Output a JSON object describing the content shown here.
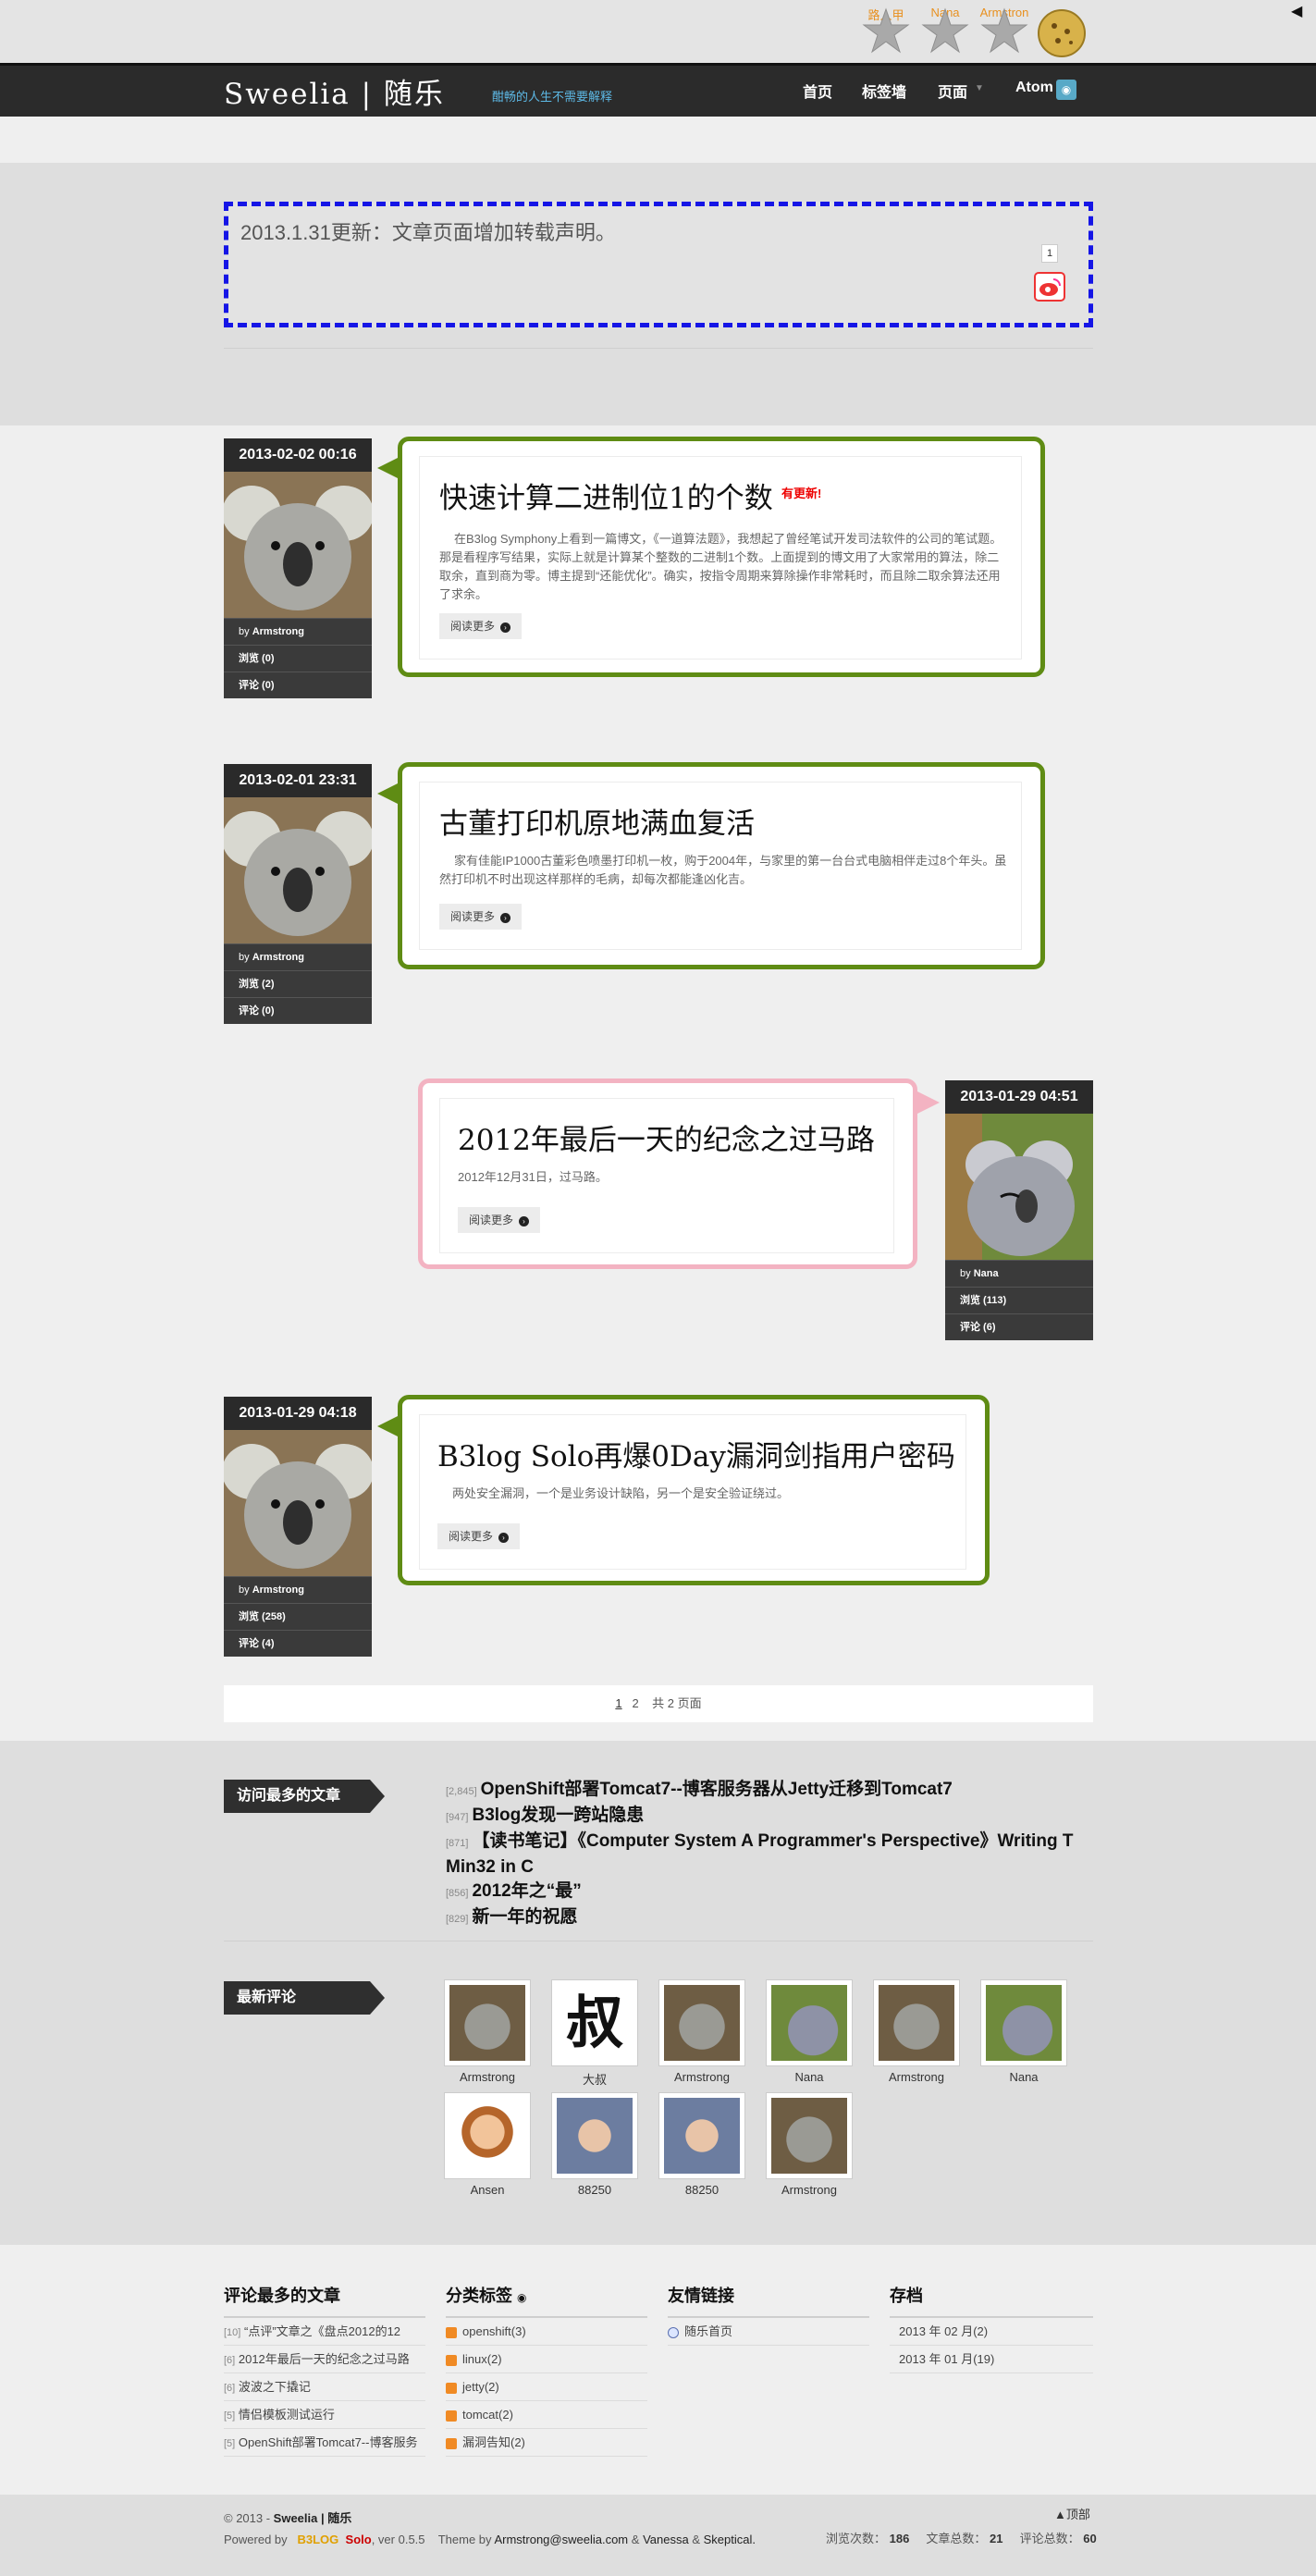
{
  "topbar": {
    "users": [
      {
        "name": "路人甲"
      },
      {
        "name": "Nana"
      },
      {
        "name": "Armstron"
      }
    ],
    "corner_icon": "arrow-left-icon"
  },
  "header": {
    "logo": "Sweelia | 随乐",
    "slogan": "酣畅的人生不需要解释",
    "nav": [
      "首页",
      "标签墙",
      "页面",
      "Atom"
    ]
  },
  "notice": {
    "text": "2013.1.31更新：文章页面增加转载声明。",
    "share_count": "1"
  },
  "posts": [
    {
      "date": "2013-02-02 00:16",
      "author_prefix": "by",
      "author": "Armstrong",
      "views": "浏览 (0)",
      "comments": "评论 (0)",
      "title": "快速计算二进制位1的个数",
      "badge": "有更新!",
      "summary": "在B3log Symphony上看到一篇博文，《一道算法题》，我想起了曾经笔试开发司法软件的公司的笔试题。那是看程序写结果，实际上就是计算某个整数的二进制1个数。上面提到的博文用了大家常用的算法，除二取余，直到商为零。博主提到“还能优化”。确实，按指令周期来算除操作非常耗时，而且除二取余算法还用了求余。",
      "more": "阅读更多"
    },
    {
      "date": "2013-02-01 23:31",
      "author_prefix": "by",
      "author": "Armstrong",
      "views": "浏览 (2)",
      "comments": "评论 (0)",
      "title": "古董打印机原地满血复活",
      "summary": "家有佳能IP1000古董彩色喷墨打印机一枚，购于2004年，与家里的第一台台式电脑相伴走过8个年头。虽然打印机不时出现这样那样的毛病，却每次都能逢凶化吉。",
      "more": "阅读更多"
    },
    {
      "date": "2013-01-29 04:51",
      "author_prefix": "by",
      "author": "Nana",
      "views": "浏览 (113)",
      "comments": "评论 (6)",
      "title": "2012年最后一天的纪念之过马路",
      "summary": "2012年12月31日，过马路。",
      "more": "阅读更多"
    },
    {
      "date": "2013-01-29 04:18",
      "author_prefix": "by",
      "author": "Armstrong",
      "views": "浏览 (258)",
      "comments": "评论 (4)",
      "title": "B3log Solo再爆0Day漏洞剑指用户密码",
      "summary": "两处安全漏洞，一个是业务设计缺陷，另一个是安全验证绕过。",
      "more": "阅读更多"
    }
  ],
  "pager": {
    "pages": [
      "1",
      "2"
    ],
    "total": "共 2 页面"
  },
  "most_viewed": {
    "label": "访问最多的文章",
    "items": [
      {
        "count": "[2,845]",
        "title": "OpenShift部署Tomcat7--博客服务器从Jetty迁移到Tomcat7"
      },
      {
        "count": "[947]",
        "title": "B3log发现一跨站隐患"
      },
      {
        "count": "[871]",
        "title": "【读书笔记】《Computer System A Programmer's Perspective》Writing T Min32 in C"
      },
      {
        "count": "[856]",
        "title": "2012年之“最”"
      },
      {
        "count": "[829]",
        "title": "新一年的祝愿"
      }
    ]
  },
  "recent_comments": {
    "label": "最新评论",
    "users": [
      "Armstrong",
      "大叔",
      "Armstrong",
      "Nana",
      "Armstrong",
      "Nana",
      "Ansen",
      "88250",
      "88250",
      "Armstrong"
    ]
  },
  "footer_widgets": {
    "most_commented": {
      "title": "评论最多的文章",
      "items": [
        {
          "count": "[10]",
          "text": "“点评”文章之《盘点2012的12"
        },
        {
          "count": "[6]",
          "text": "2012年最后一天的纪念之过马路"
        },
        {
          "count": "[6]",
          "text": "波波之下撬记"
        },
        {
          "count": "[5]",
          "text": "情侣模板测试运行"
        },
        {
          "count": "[5]",
          "text": "OpenShift部署Tomcat7--博客服务"
        }
      ]
    },
    "tags": {
      "title": "分类标签",
      "items": [
        "openshift(3)",
        "linux(2)",
        "jetty(2)",
        "tomcat(2)",
        "漏洞告知(2)"
      ]
    },
    "links": {
      "title": "友情链接",
      "items": [
        "随乐首页"
      ]
    },
    "archive": {
      "title": "存档",
      "items": [
        "2013 年 02 月(2)",
        "2013 年 01 月(19)"
      ]
    }
  },
  "footer": {
    "copyright": "© 2013 - ",
    "site": "Sweelia | 随乐",
    "powered": "Powered by",
    "b3log": "B3LOG",
    "solo": "Solo",
    "version": ", ver 0.5.5",
    "theme_by": "Theme by",
    "theme_author": "Armstrong@sweelia.com",
    "amp1": "&",
    "vanessa": "Vanessa",
    "amp2": "&",
    "skeptical": "Skeptical.",
    "top": "顶部",
    "stats": [
      {
        "label": "浏览次数：",
        "value": "186"
      },
      {
        "label": "文章总数：",
        "value": "21"
      },
      {
        "label": "评论总数：",
        "value": "60"
      }
    ]
  },
  "colors": {
    "green_border": "#5f8c14",
    "pink_border": "#f3b3c2",
    "notice_border": "#1515e6",
    "nav_bg": "#2b2b2b"
  }
}
